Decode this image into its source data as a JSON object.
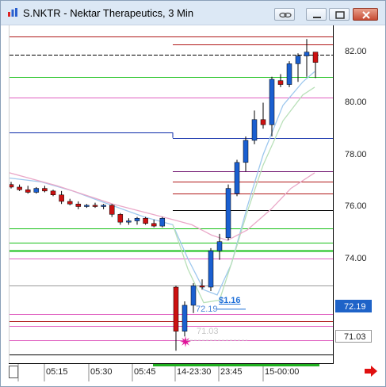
{
  "window": {
    "title": "S.NKTR - Nektar Therapeutics, 3 Min"
  },
  "colors": {
    "bullish_candle": "#1a5fd0",
    "bearish_candle": "#cc1111",
    "last_price_tag_bg": "#1e63c8",
    "support_green": "#18c018",
    "resistance_red": "#b01818",
    "level_navy": "#0a2aa8",
    "level_purple": "#6a0a6a",
    "ma_light_blue": "#9ec8ee",
    "ma_light_green": "#b8e0b8",
    "ma_pink": "#eaa8c8"
  },
  "price_axis": {
    "ticks": [
      "82.00",
      "80.00",
      "78.00",
      "76.00",
      "74.00"
    ],
    "last_price": "72.19",
    "low_marker": "71.03"
  },
  "time_axis": {
    "labels": [
      "05:15",
      "05:30",
      "05:45",
      "14-23:30",
      "23:45",
      "15-00:00"
    ]
  },
  "annotations": {
    "bounce_price": "72.19",
    "bounce_gain": "$1.16",
    "low_price": "71.03"
  },
  "chart_data": {
    "type": "candlestick",
    "title": "S.NKTR - Nektar Therapeutics, 3 Min",
    "ylim": [
      70.2,
      83.2
    ],
    "x_ticks": [
      "05:15",
      "05:30",
      "05:45",
      "14-23:30",
      "23:45",
      "15-00:00"
    ],
    "candles_premarket": [
      {
        "o": 76.85,
        "h": 76.95,
        "l": 76.7,
        "c": 76.75
      },
      {
        "o": 76.75,
        "h": 76.85,
        "l": 76.6,
        "c": 76.65
      },
      {
        "o": 76.65,
        "h": 76.8,
        "l": 76.5,
        "c": 76.55
      },
      {
        "o": 76.55,
        "h": 76.75,
        "l": 76.5,
        "c": 76.7
      },
      {
        "o": 76.7,
        "h": 76.8,
        "l": 76.55,
        "c": 76.6
      },
      {
        "o": 76.6,
        "h": 76.65,
        "l": 76.4,
        "c": 76.45
      },
      {
        "o": 76.45,
        "h": 76.6,
        "l": 76.1,
        "c": 76.2
      },
      {
        "o": 76.2,
        "h": 76.3,
        "l": 76.05,
        "c": 76.1
      },
      {
        "o": 76.1,
        "h": 76.2,
        "l": 75.9,
        "c": 76.0
      },
      {
        "o": 76.0,
        "h": 76.1,
        "l": 75.95,
        "c": 76.05
      },
      {
        "o": 76.05,
        "h": 76.15,
        "l": 75.95,
        "c": 76.0
      },
      {
        "o": 76.0,
        "h": 76.1,
        "l": 75.9,
        "c": 76.05
      },
      {
        "o": 76.05,
        "h": 76.1,
        "l": 75.6,
        "c": 75.7
      },
      {
        "o": 75.7,
        "h": 75.75,
        "l": 75.3,
        "c": 75.4
      },
      {
        "o": 75.4,
        "h": 75.55,
        "l": 75.3,
        "c": 75.45
      },
      {
        "o": 75.45,
        "h": 75.6,
        "l": 75.3,
        "c": 75.55
      },
      {
        "o": 75.55,
        "h": 75.6,
        "l": 75.3,
        "c": 75.35
      },
      {
        "o": 75.35,
        "h": 75.5,
        "l": 75.2,
        "c": 75.25
      },
      {
        "o": 75.25,
        "h": 75.6,
        "l": 75.2,
        "c": 75.55
      }
    ],
    "candles_session": [
      {
        "o": 72.9,
        "h": 72.95,
        "l": 70.45,
        "c": 71.2
      },
      {
        "o": 71.2,
        "h": 72.35,
        "l": 71.0,
        "c": 72.2
      },
      {
        "o": 72.2,
        "h": 73.05,
        "l": 71.9,
        "c": 72.95
      },
      {
        "o": 72.95,
        "h": 73.2,
        "l": 72.8,
        "c": 72.9
      },
      {
        "o": 72.9,
        "h": 74.4,
        "l": 72.75,
        "c": 74.3
      },
      {
        "o": 74.3,
        "h": 74.95,
        "l": 73.95,
        "c": 74.65
      },
      {
        "o": 74.8,
        "h": 76.85,
        "l": 74.7,
        "c": 76.7
      },
      {
        "o": 76.5,
        "h": 77.8,
        "l": 76.4,
        "c": 77.7
      },
      {
        "o": 77.7,
        "h": 78.7,
        "l": 77.35,
        "c": 78.55
      },
      {
        "o": 78.55,
        "h": 79.7,
        "l": 78.4,
        "c": 79.35
      },
      {
        "o": 79.35,
        "h": 80.0,
        "l": 79.0,
        "c": 79.15
      },
      {
        "o": 79.15,
        "h": 81.0,
        "l": 78.7,
        "c": 80.9
      },
      {
        "o": 80.85,
        "h": 81.1,
        "l": 80.6,
        "c": 80.7
      },
      {
        "o": 80.7,
        "h": 81.6,
        "l": 80.6,
        "c": 81.5
      },
      {
        "o": 81.5,
        "h": 81.9,
        "l": 80.8,
        "c": 81.8
      },
      {
        "o": 81.8,
        "h": 82.45,
        "l": 81.0,
        "c": 81.95
      },
      {
        "o": 81.95,
        "h": 81.95,
        "l": 80.95,
        "c": 81.55
      }
    ],
    "levels": [
      {
        "price": 82.55,
        "color": "#b01818",
        "side": "both"
      },
      {
        "price": 82.25,
        "color": "#b01818",
        "side": "right"
      },
      {
        "price": 81.85,
        "color": "#000000",
        "side": "both",
        "dashed": true
      },
      {
        "price": 81.0,
        "color": "#18c018",
        "side": "both"
      },
      {
        "price": 80.2,
        "color": "#e060c0",
        "side": "both"
      },
      {
        "price": 78.85,
        "color": "#0a2aa8",
        "side": "left"
      },
      {
        "price": 78.65,
        "color": "#0a2aa8",
        "side": "right"
      },
      {
        "price": 77.35,
        "color": "#6a0a6a",
        "side": "right"
      },
      {
        "price": 76.95,
        "color": "#b01818",
        "side": "right"
      },
      {
        "price": 76.5,
        "color": "#b01818",
        "side": "right"
      },
      {
        "price": 75.85,
        "color": "#000000",
        "side": "right"
      },
      {
        "price": 75.15,
        "color": "#18c018",
        "side": "both"
      },
      {
        "price": 74.6,
        "color": "#18c018",
        "side": "both"
      },
      {
        "price": 74.3,
        "color": "#18c018",
        "side": "both",
        "thick": true
      },
      {
        "price": 74.0,
        "color": "#e060c0",
        "side": "both"
      },
      {
        "price": 72.95,
        "color": "#999999",
        "side": "both"
      },
      {
        "price": 71.85,
        "color": "#e060c0",
        "side": "both"
      },
      {
        "price": 71.6,
        "color": "#b01818",
        "side": "both"
      },
      {
        "price": 71.4,
        "color": "#e060c0",
        "side": "both"
      },
      {
        "price": 70.85,
        "color": "#e060c0",
        "side": "both"
      },
      {
        "price": 70.3,
        "color": "#000000",
        "side": "both"
      }
    ]
  }
}
